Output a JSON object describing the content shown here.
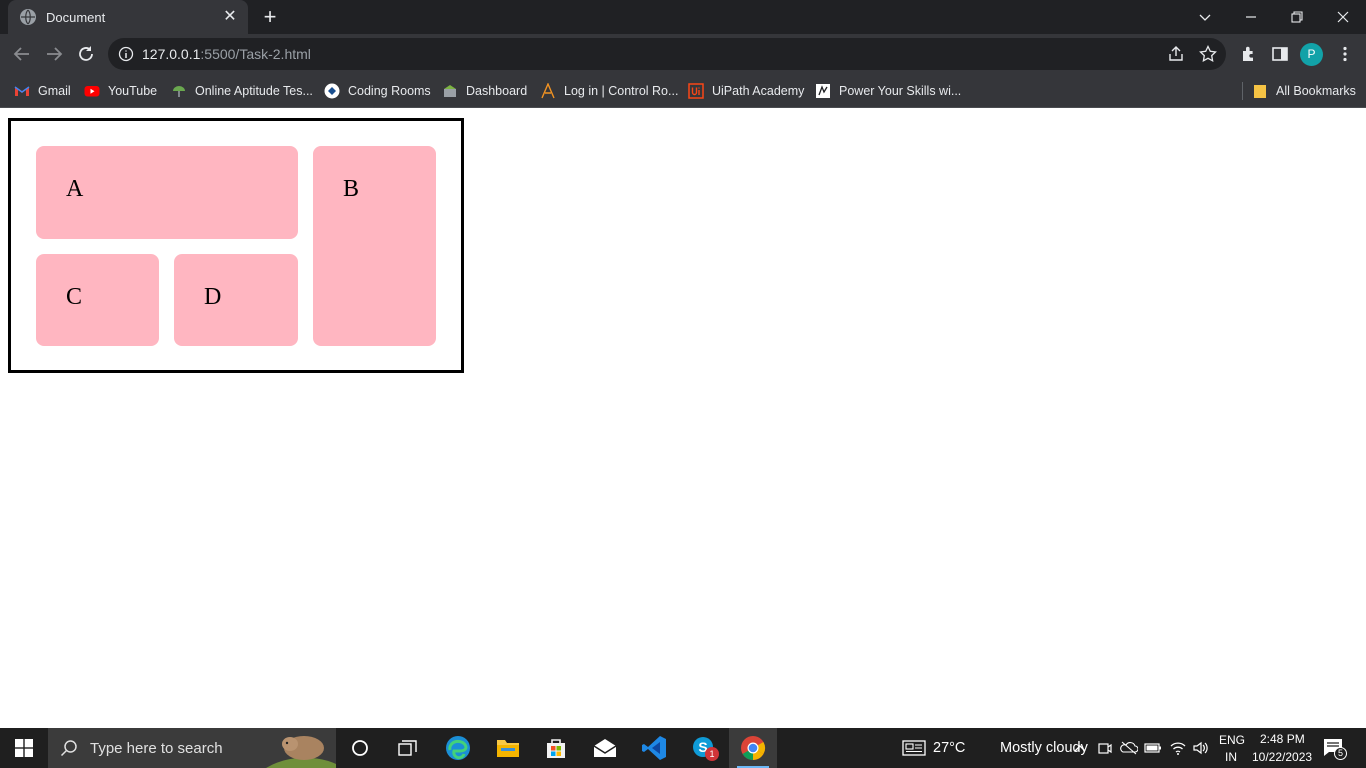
{
  "browser": {
    "tab_title": "Document",
    "tab_close": "✕",
    "new_tab": "+",
    "url_host": "127.0.0.1",
    "url_path": ":5500/Task-2.html",
    "profile_initial": "P"
  },
  "bookmarks": [
    {
      "label": "Gmail",
      "icon": "gmail-icon"
    },
    {
      "label": "YouTube",
      "icon": "youtube-icon"
    },
    {
      "label": "Online Aptitude Tes...",
      "icon": "aptitude-icon"
    },
    {
      "label": "Coding Rooms",
      "icon": "coding-rooms-icon"
    },
    {
      "label": "Dashboard",
      "icon": "dashboard-icon"
    },
    {
      "label": "Log in | Control Ro...",
      "icon": "control-room-icon"
    },
    {
      "label": "UiPath Academy",
      "icon": "uipath-icon"
    },
    {
      "label": "Power Your Skills wi...",
      "icon": "power-skills-icon"
    }
  ],
  "all_bookmarks": "All Bookmarks",
  "page": {
    "cells": {
      "a": "A",
      "b": "B",
      "c": "C",
      "d": "D"
    },
    "cell_color": "#ffb6c1"
  },
  "taskbar": {
    "search_placeholder": "Type here to search",
    "weather_temp": "27°C",
    "weather_desc": "Mostly cloudy",
    "lang_top": "ENG",
    "lang_bottom": "IN",
    "time": "2:48 PM",
    "date": "10/22/2023",
    "notification_count": "5",
    "skype_badge": "1"
  }
}
